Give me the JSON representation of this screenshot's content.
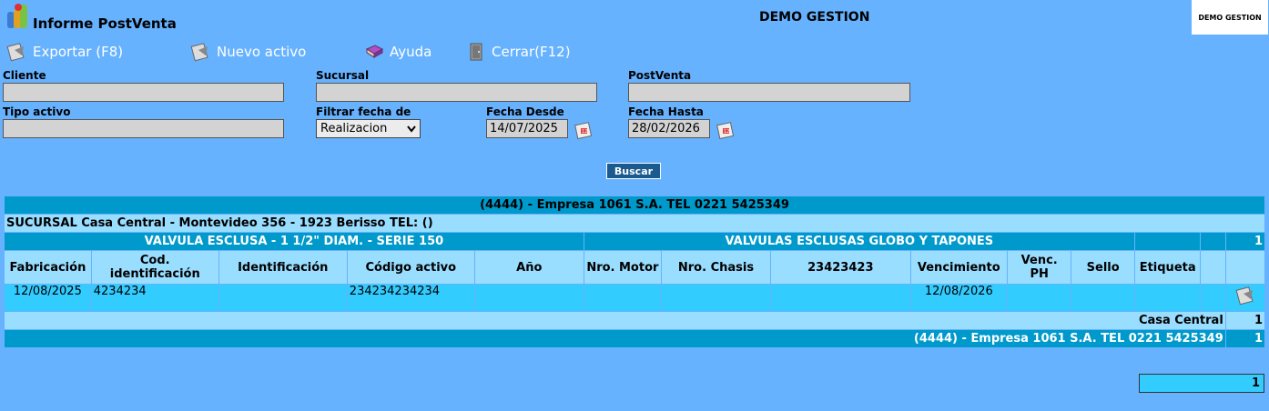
{
  "header": {
    "app_title": "Informe PostVenta",
    "center_title": "DEMO GESTION",
    "brand_text": "DEMO GESTION"
  },
  "toolbar": {
    "export_label": "Exportar (F8)",
    "new_label": "Nuevo activo",
    "help_label": "Ayuda",
    "close_label": "Cerrar(F12)"
  },
  "filters": {
    "cliente_label": "Cliente",
    "cliente_value": "",
    "sucursal_label": "Sucursal",
    "sucursal_value": "",
    "postventa_label": "PostVenta",
    "postventa_value": "",
    "tipo_label": "Tipo activo",
    "tipo_value": "",
    "filtrar_label": "Filtrar fecha de",
    "filtrar_value": "Realizacion",
    "desde_label": "Fecha Desde",
    "desde_value": "14/07/2025",
    "hasta_label": "Fecha Hasta",
    "hasta_value": "28/02/2026",
    "buscar_label": "Buscar"
  },
  "results": {
    "empresa": "(4444) - Empresa 1061 S.A. TEL 0221 5425349",
    "sucursal": "SUCURSAL Casa Central - Montevideo 356 - 1923 Berisso TEL: ()",
    "producto": "VALVULA ESCLUSA - 1 1/2\" DIAM. - SERIE 150",
    "familia": "VALVULAS ESCLUSAS GLOBO Y TAPONES",
    "producto_count": "1",
    "headers": {
      "fabricacion": "Fabricación",
      "cod1": "Cod.",
      "cod2": "identificación",
      "identificacion": "Identificación",
      "codigo_activo": "Código activo",
      "anio": "Año",
      "motor": "Nro. Motor",
      "chasis": "Nro. Chasis",
      "extra": "23423423",
      "vencimiento": "Vencimiento",
      "vencph1": "Venc.",
      "vencph2": "PH",
      "sello": "Sello",
      "etiqueta": "Etiqueta"
    },
    "row": {
      "fabricacion": "12/08/2025",
      "cod_identificacion": "4234234",
      "identificacion": "",
      "codigo_activo": "234234234234",
      "anio": "",
      "motor": "",
      "chasis": "",
      "extra": "",
      "vencimiento": "12/08/2026",
      "vencph": "",
      "sello": "",
      "etiqueta": ""
    },
    "total_sucursal_label": "Casa Central",
    "total_sucursal": "1",
    "total_empresa_label": "(4444) - Empresa 1061 S.A. TEL 0221 5425349",
    "total_empresa": "1",
    "grand_total": "1"
  }
}
